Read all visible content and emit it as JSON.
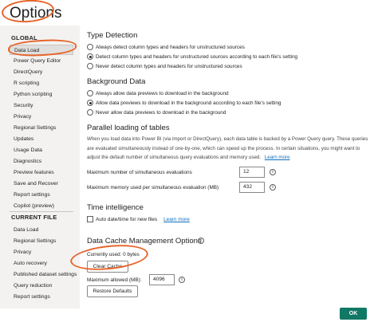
{
  "window": {
    "title": "Options"
  },
  "sidebar": {
    "global_header": "GLOBAL",
    "global_items": [
      {
        "label": "Data Load",
        "active": true
      },
      {
        "label": "Power Query Editor"
      },
      {
        "label": "DirectQuery"
      },
      {
        "label": "R scripting"
      },
      {
        "label": "Python scripting"
      },
      {
        "label": "Security"
      },
      {
        "label": "Privacy"
      },
      {
        "label": "Regional Settings"
      },
      {
        "label": "Updates"
      },
      {
        "label": "Usage Data"
      },
      {
        "label": "Diagnostics"
      },
      {
        "label": "Preview features"
      },
      {
        "label": "Save and Recover"
      },
      {
        "label": "Report settings"
      },
      {
        "label": "Copilot (preview)"
      }
    ],
    "current_header": "CURRENT FILE",
    "current_items": [
      {
        "label": "Data Load"
      },
      {
        "label": "Regional Settings"
      },
      {
        "label": "Privacy"
      },
      {
        "label": "Auto recovery"
      },
      {
        "label": "Published dataset settings"
      },
      {
        "label": "Query reduction"
      },
      {
        "label": "Report settings"
      }
    ]
  },
  "type_detection": {
    "title": "Type Detection",
    "options": [
      {
        "label": "Always detect column types and headers for unstructured sources",
        "selected": false
      },
      {
        "label": "Detect column types and headers for unstructured sources according to each file's setting",
        "selected": true
      },
      {
        "label": "Never detect column types and headers for unstructured sources",
        "selected": false
      }
    ]
  },
  "background_data": {
    "title": "Background Data",
    "options": [
      {
        "label": "Always allow data previews to download in the background",
        "selected": false
      },
      {
        "label": "Allow data previews to download in the background according to each file's setting",
        "selected": true
      },
      {
        "label": "Never allow data previews to download in the background",
        "selected": false
      }
    ]
  },
  "parallel": {
    "title": "Parallel loading of tables",
    "description": "When you load data into Power BI (via import or DirectQuery), each data table is backed by a Power Query query. These queries are evaluated simultaneously instead of one-by-one, which can speed up the process. In certain situations, you might want to adjust the default number of simultaneous query evaluations and memory used.",
    "learn_more": "Learn more",
    "max_evaluations_label": "Maximum number of simultaneous evaluations",
    "max_evaluations_value": "12",
    "max_memory_label": "Maximum memory used per simultaneous evaluation (MB)",
    "max_memory_value": "432"
  },
  "time_intelligence": {
    "title": "Time intelligence",
    "auto_date_label": "Auto date/time for new files",
    "learn_more": "Learn more"
  },
  "cache": {
    "title": "Data Cache Management Options",
    "currently_used": "Currently used: 0 bytes",
    "clear_button": "Clear Cache",
    "max_allowed_label": "Maximum allowed (MB):",
    "max_allowed_value": "4096",
    "restore_button": "Restore Defaults"
  },
  "footer": {
    "ok_label": "OK"
  },
  "colors": {
    "annotation": "#e8642a",
    "ok_button": "#117865",
    "link": "#106ebe"
  }
}
